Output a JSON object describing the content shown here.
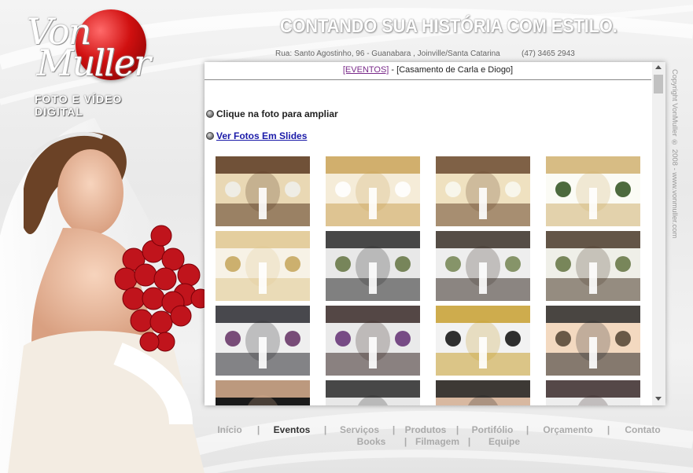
{
  "logo": {
    "script_text": "Von\n Muller",
    "subtitle": "FOTO E VÍDEO DIGITAL"
  },
  "header": {
    "tagline": "CONTANDO SUA HISTÓRIA COM ESTILO.",
    "address": "Rua: Santo Agostinho, 96 - Guanabara , Joinville/Santa Catarina",
    "phone": "(47) 3465 2943"
  },
  "copyright": "Copyright VonMuller ® 2008 - www.vonmuller.com",
  "content": {
    "breadcrumb_link": "[EVENTOS]",
    "breadcrumb_sep": " - ",
    "breadcrumb_current": "[Casamento de Carla e Diogo]",
    "hint": "Clique na foto para ampliar",
    "slides_link": "Ver Fotos Em Slides",
    "thumbnail_count": 16
  },
  "nav": {
    "row1": [
      "Início",
      "Eventos",
      "Serviços",
      "Produtos",
      "Portifólio",
      "Orçamento",
      "Contato"
    ],
    "row2": [
      "Books",
      "Filmagem",
      "Equipe"
    ],
    "separator": "|",
    "active": "Eventos"
  },
  "colors": {
    "logo_red": "#c41010",
    "link_purple": "#7a2b8a",
    "link_blue": "#1a1aa8",
    "nav_gray": "#aaaaaa",
    "nav_active": "#333333"
  }
}
